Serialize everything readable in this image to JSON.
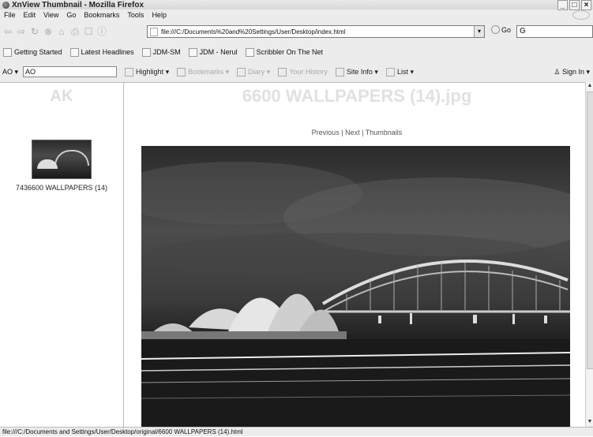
{
  "window": {
    "title": "XnView Thumbnail - Mozilla Firefox",
    "controls": [
      "_",
      "̅",
      "×"
    ]
  },
  "menu": {
    "items": [
      "File",
      "Edit",
      "View",
      "Go",
      "Bookmarks",
      "Tools",
      "Help"
    ]
  },
  "nav": {
    "url": "file:///C:/Documents%20and%20Settings/User/Desktop/index.html",
    "go_label": "Go",
    "search_placeholder": "G"
  },
  "bookmarks": {
    "items": [
      "Getting Started",
      "Latest Headlines",
      "JDM-SM",
      "JDM - Nerul",
      "Scribbler On The Net"
    ]
  },
  "addon": {
    "left_label": "AO",
    "combo_value": "AO",
    "items": [
      "Highlight",
      "Bookmarks",
      "Diary",
      "Your History",
      "Site Info",
      "List"
    ],
    "signin": "Sign In"
  },
  "left": {
    "heading": "AK",
    "thumb_caption": "7436600 WALLPAPERS (14)"
  },
  "main": {
    "image_title": "6600 WALLPAPERS (14).jpg",
    "links": {
      "previous": "Previous",
      "next": "Next",
      "thumbnails": "Thumbnails",
      "sep": "|"
    }
  },
  "status": {
    "text": "file:///C:/Documents and Settings/User/Desktop/original/6600 WALLPAPERS (14).html"
  },
  "colors": {
    "background": "#ececec",
    "title_watermark": "#e1e1e1"
  }
}
